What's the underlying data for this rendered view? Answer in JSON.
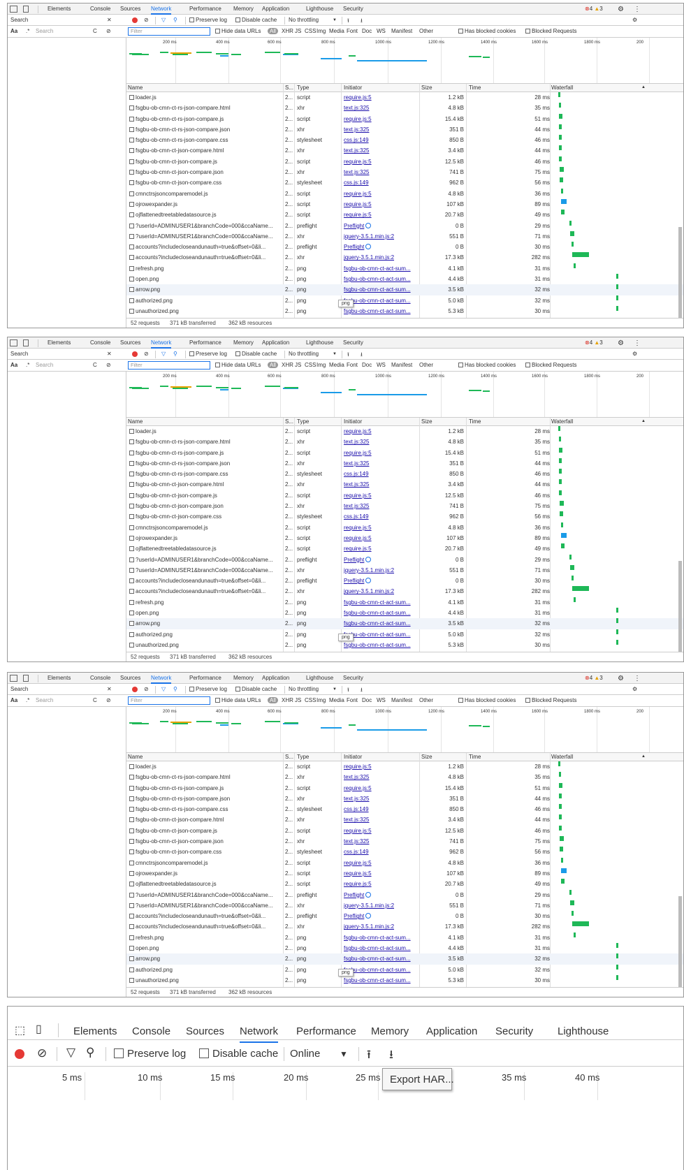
{
  "devtools": {
    "tabs": [
      "Elements",
      "Console",
      "Sources",
      "Network",
      "Performance",
      "Memory",
      "Application",
      "Lighthouse",
      "Security"
    ],
    "active_tab": "Network",
    "errors": "4",
    "warnings": "3",
    "search_label": "Search",
    "aa": "Aa",
    "regex": ".*",
    "search_placeholder": "Search",
    "preserve_log": "Preserve log",
    "disable_cache": "Disable cache",
    "throttling": "No throttling",
    "filter_placeholder": "Filter",
    "hide_data_urls": "Hide data URLs",
    "all": "All",
    "filter_types": [
      "XHR",
      "JS",
      "CSS",
      "Img",
      "Media",
      "Font",
      "Doc",
      "WS",
      "Manifest",
      "Other"
    ],
    "has_blocked_cookies": "Has blocked cookies",
    "blocked_requests": "Blocked Requests",
    "ticks": [
      "200 ms",
      "400 ms",
      "600 ms",
      "800 ms",
      "1000 ms",
      "1200 ms",
      "1400 ms",
      "1600 ms",
      "1800 ms",
      "200"
    ],
    "columns": {
      "name": "Name",
      "status": "S...",
      "type": "Type",
      "initiator": "Initiator",
      "size": "Size",
      "time": "Time",
      "waterfall": "Waterfall"
    },
    "rows": [
      {
        "name": "loader.js",
        "s": "2...",
        "type": "script",
        "init": "require.js:5",
        "size": "1.2 kB",
        "time": "28 ms",
        "wf": 0.06
      },
      {
        "name": "fsgbu-ob-cmn-ct-rs-json-compare.html",
        "s": "2...",
        "type": "xhr",
        "init": "text.js:325",
        "size": "4.8 kB",
        "time": "35 ms",
        "wf": 0.07
      },
      {
        "name": "fsgbu-ob-cmn-ct-rs-json-compare.js",
        "s": "2...",
        "type": "script",
        "init": "require.js:5",
        "size": "15.4 kB",
        "time": "51 ms",
        "wf": 0.07
      },
      {
        "name": "fsgbu-ob-cmn-ct-rs-json-compare.json",
        "s": "2...",
        "type": "xhr",
        "init": "text.js:325",
        "size": "351 B",
        "time": "44 ms",
        "wf": 0.07
      },
      {
        "name": "fsgbu-ob-cmn-ct-rs-json-compare.css",
        "s": "2...",
        "type": "stylesheet",
        "init": "css.js:149",
        "size": "850 B",
        "time": "46 ms",
        "wf": 0.07
      },
      {
        "name": "fsgbu-ob-cmn-ct-json-compare.html",
        "s": "2...",
        "type": "xhr",
        "init": "text.js:325",
        "size": "3.4 kB",
        "time": "44 ms",
        "wf": 0.07
      },
      {
        "name": "fsgbu-ob-cmn-ct-json-compare.js",
        "s": "2...",
        "type": "script",
        "init": "require.js:5",
        "size": "12.5 kB",
        "time": "46 ms",
        "wf": 0.07
      },
      {
        "name": "fsgbu-ob-cmn-ct-json-compare.json",
        "s": "2...",
        "type": "xhr",
        "init": "text.js:325",
        "size": "741 B",
        "time": "75 ms",
        "wf": 0.075
      },
      {
        "name": "fsgbu-ob-cmn-ct-json-compare.css",
        "s": "2...",
        "type": "stylesheet",
        "init": "css.js:149",
        "size": "962 B",
        "time": "56 ms",
        "wf": 0.075
      },
      {
        "name": "cmnctrsjsoncomparemodel.js",
        "s": "2...",
        "type": "script",
        "init": "require.js:5",
        "size": "4.8 kB",
        "time": "36 ms",
        "wf": 0.09
      },
      {
        "name": "ojrowexpander.js",
        "s": "2...",
        "type": "script",
        "init": "require.js:5",
        "size": "107 kB",
        "time": "89 ms",
        "wf": 0.09
      },
      {
        "name": "ojflattenedtreetabledatasource.js",
        "s": "2...",
        "type": "script",
        "init": "require.js:5",
        "size": "20.7 kB",
        "time": "49 ms",
        "wf": 0.09
      },
      {
        "name": "?userId=ADMINUSER1&branchCode=000&ccaName...",
        "s": "2...",
        "type": "preflight",
        "init": "Preflight",
        "size": "0 B",
        "time": "29 ms",
        "wf": 0.16
      },
      {
        "name": "?userId=ADMINUSER1&branchCode=000&ccaName...",
        "s": "2...",
        "type": "xhr",
        "init": "jquery-3.5.1.min.js:2",
        "size": "551 B",
        "time": "71 ms",
        "wf": 0.17
      },
      {
        "name": "accounts?includecloseandunauth=true&offset=0&li...",
        "s": "2...",
        "type": "preflight",
        "init": "Preflight",
        "size": "0 B",
        "time": "30 ms",
        "wf": 0.18
      },
      {
        "name": "accounts?includecloseandunauth=true&offset=0&li...",
        "s": "2...",
        "type": "xhr",
        "init": "jquery-3.5.1.min.js:2",
        "size": "17.3 kB",
        "time": "282 ms",
        "wf": 0.19
      },
      {
        "name": "refresh.png",
        "s": "2...",
        "type": "png",
        "init": "fsgbu-ob-cmn-ct-act-sum...",
        "size": "4.1 kB",
        "time": "31 ms",
        "wf": 0.2
      },
      {
        "name": "open.png",
        "s": "2...",
        "type": "png",
        "init": "fsgbu-ob-cmn-ct-act-sum...",
        "size": "4.4 kB",
        "time": "31 ms",
        "wf": 0.58
      },
      {
        "name": "arrow.png",
        "s": "2...",
        "type": "png",
        "init": "fsgbu-ob-cmn-ct-act-sum...",
        "size": "3.5 kB",
        "time": "32 ms",
        "wf": 0.58
      },
      {
        "name": "authorized.png",
        "s": "2...",
        "type": "png",
        "init": "fsgbu-ob-cmn-ct-act-sum...",
        "size": "5.0 kB",
        "time": "32 ms",
        "wf": 0.58
      },
      {
        "name": "unauthorized.png",
        "s": "2...",
        "type": "png",
        "init": "fsgbu-ob-cmn-ct-act-sum...",
        "size": "5.3 kB",
        "time": "30 ms",
        "wf": 0.58
      }
    ],
    "tooltip": "png",
    "status": {
      "requests": "52 requests",
      "transferred": "371 kB transferred",
      "resources": "362 kB resources"
    }
  },
  "bottom": {
    "tabs": [
      "Elements",
      "Console",
      "Sources",
      "Network",
      "Performance",
      "Memory",
      "Application",
      "Security",
      "Lighthouse"
    ],
    "preserve_log": "Preserve log",
    "disable_cache": "Disable cache",
    "throttling": "Online",
    "ticks": [
      "5 ms",
      "10 ms",
      "15 ms",
      "20 ms",
      "25 ms",
      "35 ms",
      "40 ms"
    ],
    "export_har": "Export HAR..."
  },
  "colors": {
    "accent": "#1a73e8",
    "waterfall_green": "#1eb857",
    "waterfall_blue": "#1a9be8"
  }
}
